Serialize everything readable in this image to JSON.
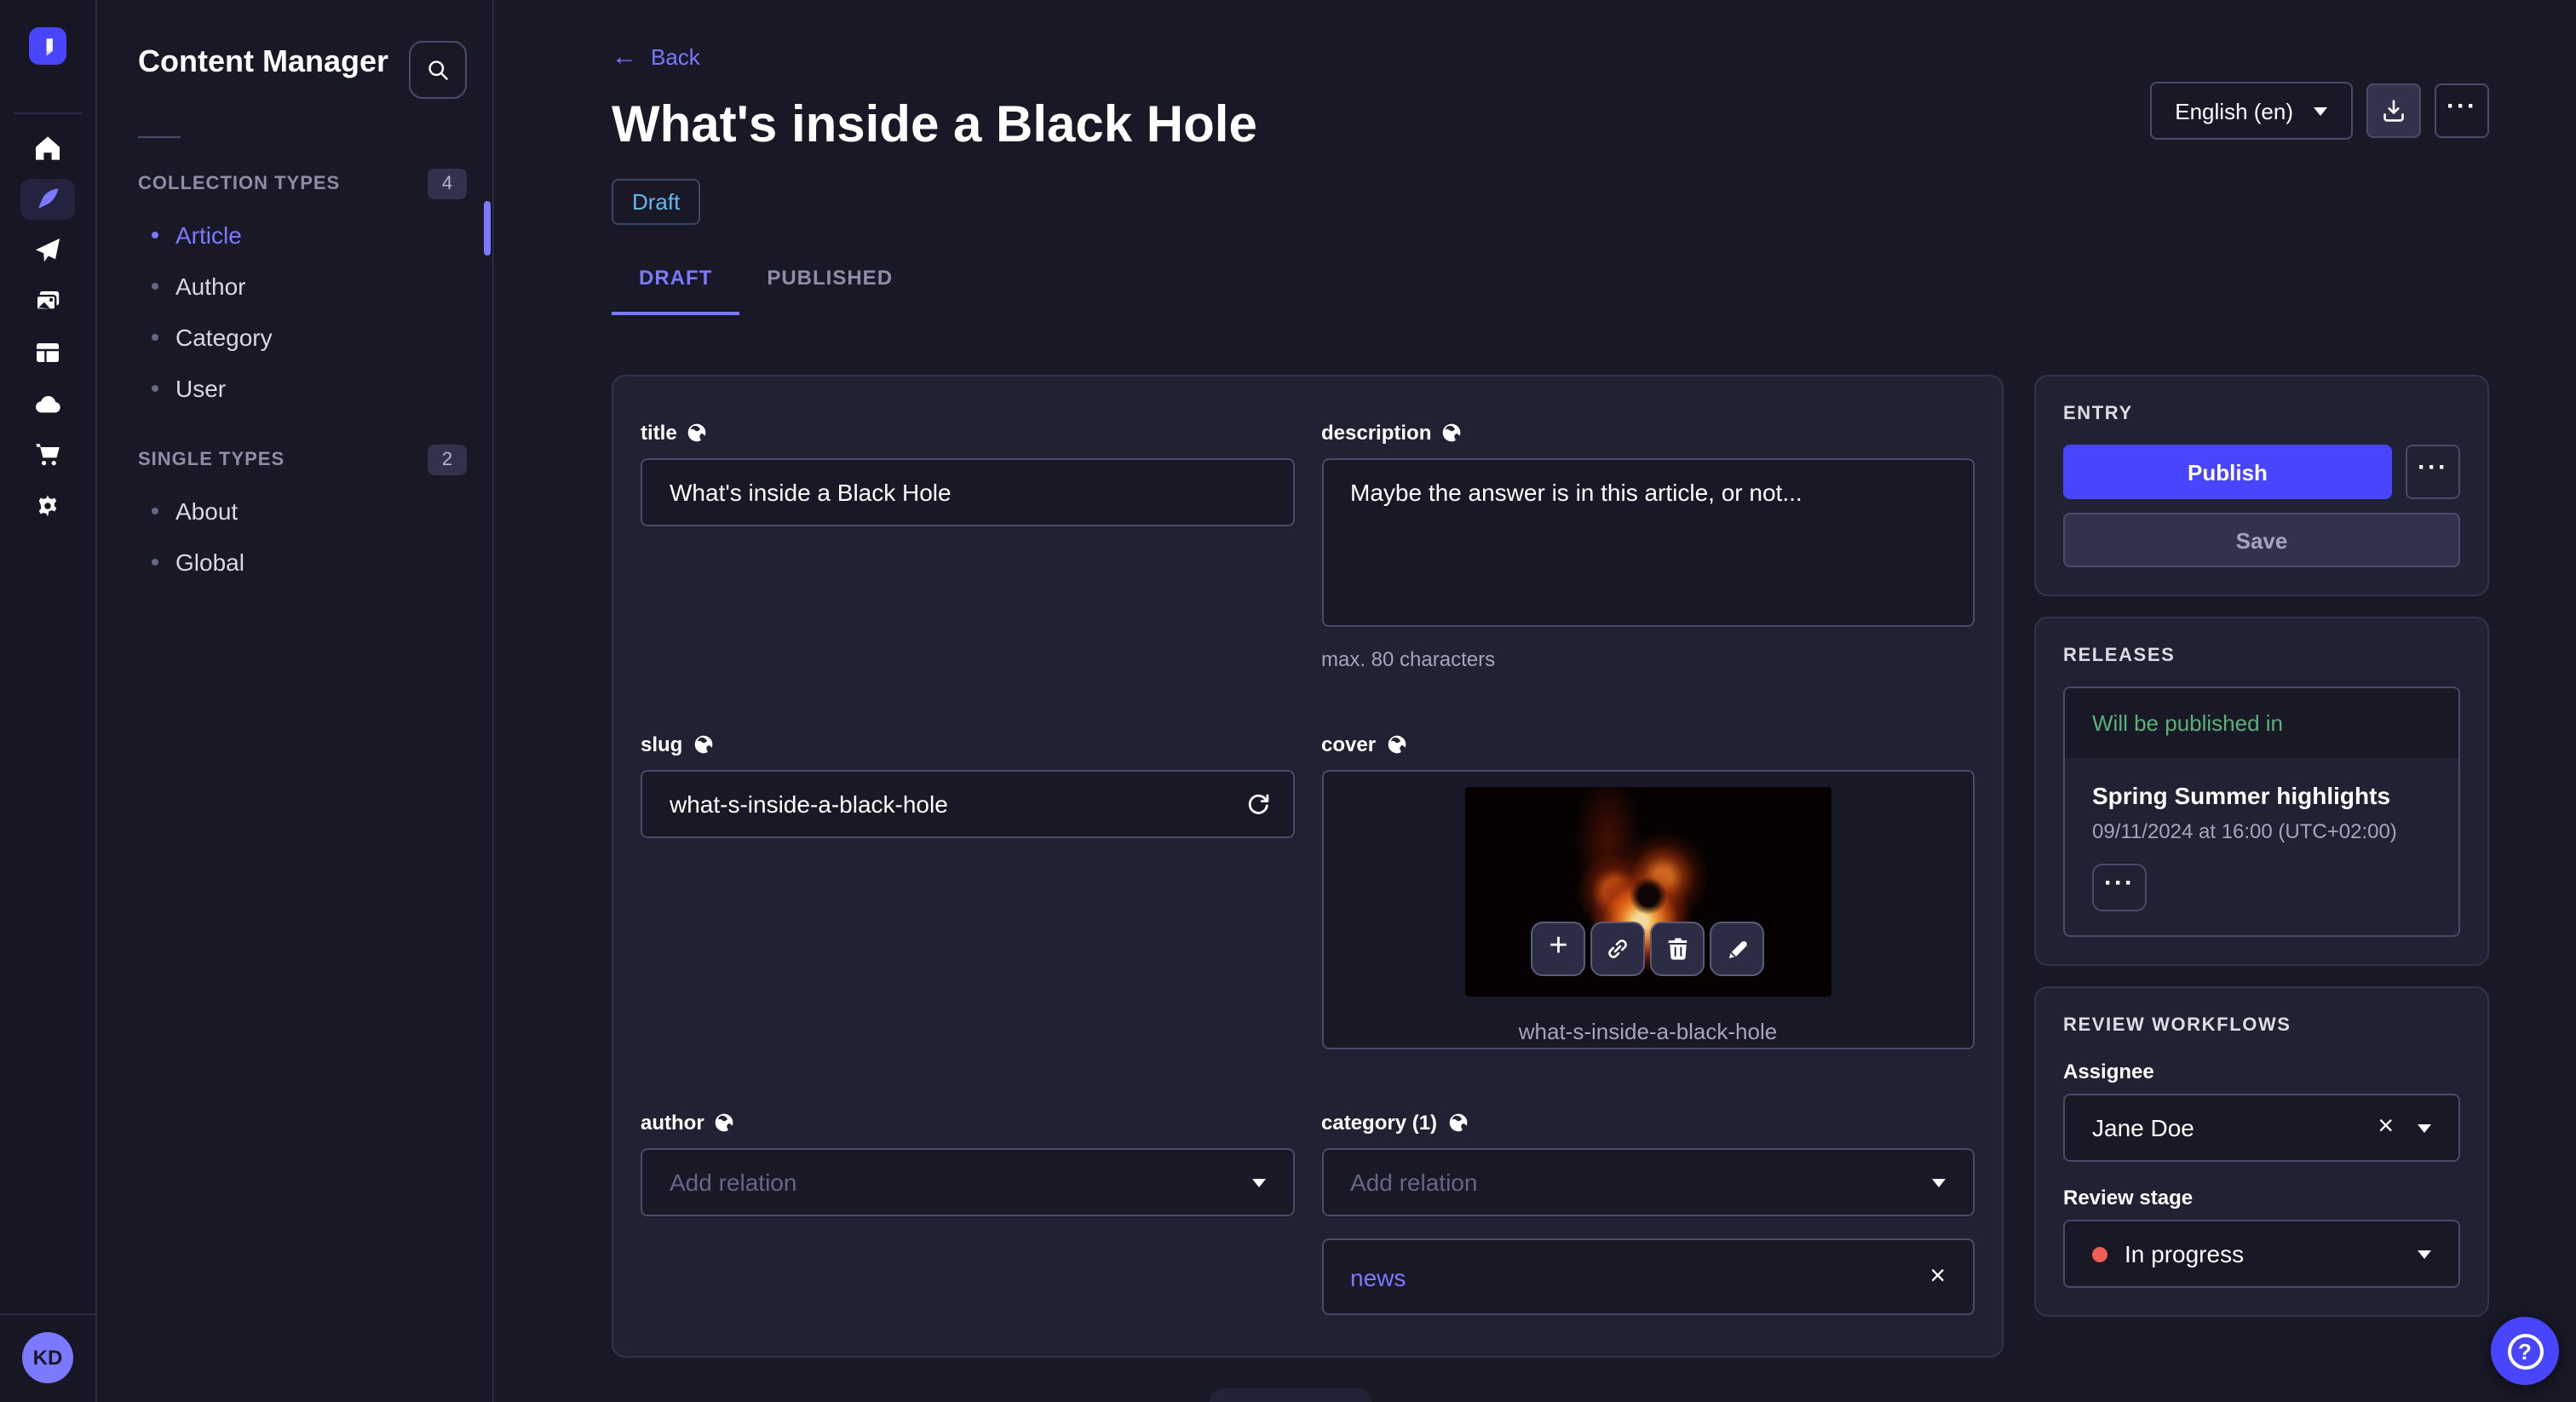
{
  "colors": {
    "accent": "#4945ff",
    "accent_light": "#7b79ff",
    "success": "#5cb176",
    "danger": "#ee5e52",
    "draft_blue": "#66b7f1"
  },
  "rail": {
    "logo_icon": "strapi-logo",
    "avatar_initials": "KD",
    "icons": [
      "home-icon",
      "feather-icon",
      "paper-plane-icon",
      "media-library-icon",
      "layout-icon",
      "cloud-icon",
      "cart-icon",
      "gear-icon"
    ],
    "active_icon": "feather-icon"
  },
  "subnav": {
    "title": "Content Manager",
    "search_icon": "search-icon",
    "sections": [
      {
        "label": "COLLECTION TYPES",
        "count": "4",
        "items": [
          {
            "label": "Article",
            "active": true
          },
          {
            "label": "Author",
            "active": false
          },
          {
            "label": "Category",
            "active": false
          },
          {
            "label": "User",
            "active": false
          }
        ]
      },
      {
        "label": "SINGLE TYPES",
        "count": "2",
        "items": [
          {
            "label": "About",
            "active": false
          },
          {
            "label": "Global",
            "active": false
          }
        ]
      }
    ]
  },
  "header": {
    "back_label": "Back",
    "title": "What's inside a Black Hole",
    "status": "Draft",
    "language": "English (en)",
    "tabs": [
      {
        "label": "DRAFT"
      },
      {
        "label": "PUBLISHED"
      }
    ]
  },
  "form": {
    "title": {
      "label": "title",
      "value": "What's inside a Black Hole"
    },
    "description": {
      "label": "description",
      "value": "Maybe the answer is in this article, or not...",
      "helper": "max. 80 characters"
    },
    "slug": {
      "label": "slug",
      "value": "what-s-inside-a-black-hole"
    },
    "cover": {
      "label": "cover",
      "caption": "what-s-inside-a-black-hole",
      "action_icons": [
        "plus-icon",
        "link-icon",
        "trash-icon",
        "pencil-icon"
      ]
    },
    "author": {
      "label": "author",
      "placeholder": "Add relation"
    },
    "category": {
      "label": "category (1)",
      "placeholder": "Add relation",
      "relations": [
        {
          "label": "news"
        }
      ]
    }
  },
  "entry": {
    "heading": "ENTRY",
    "publish_label": "Publish",
    "save_label": "Save"
  },
  "releases": {
    "heading": "RELEASES",
    "card": {
      "header": "Will be published in",
      "title": "Spring Summer highlights",
      "date": "09/11/2024 at 16:00 (UTC+02:00)"
    }
  },
  "review": {
    "heading": "REVIEW WORKFLOWS",
    "assignee_label": "Assignee",
    "assignee_value": "Jane Doe",
    "stage_label": "Review stage",
    "stage_value": "In progress"
  }
}
